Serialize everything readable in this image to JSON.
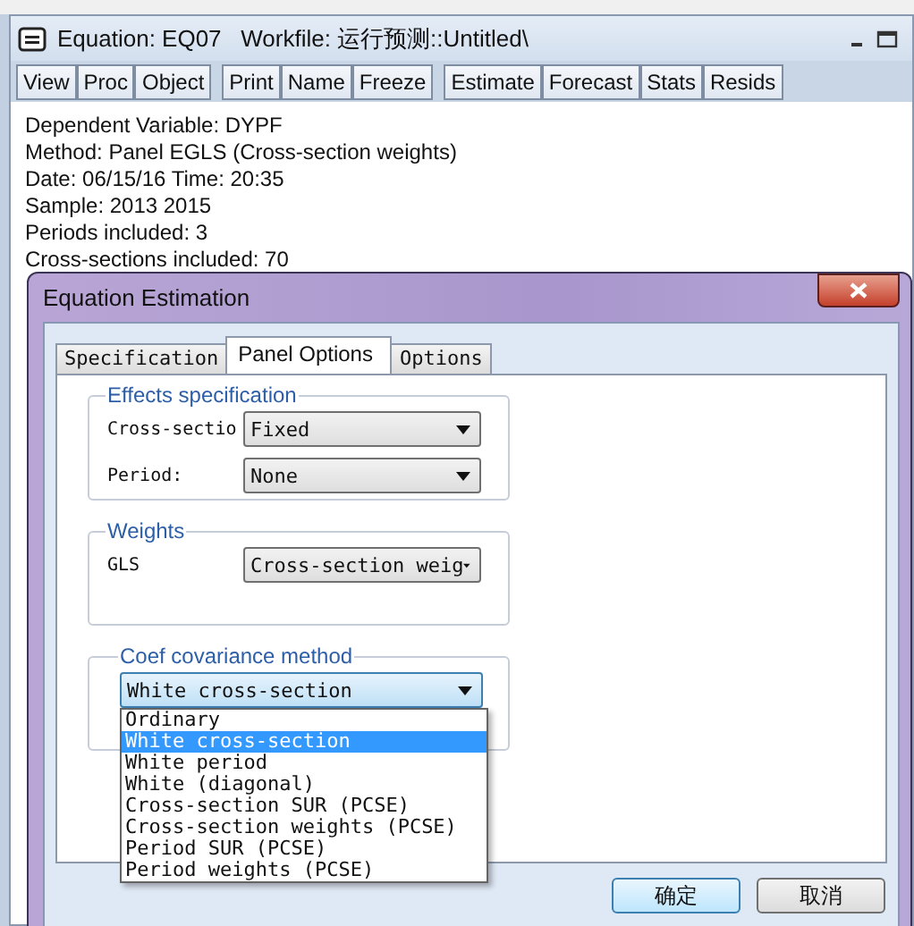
{
  "main_window": {
    "title": "Equation: EQ07   Workfile: 运行预测::Untitled\\",
    "toolbar": [
      [
        "View",
        "Proc",
        "Object"
      ],
      [
        "Print",
        "Name",
        "Freeze"
      ],
      [
        "Estimate",
        "Forecast",
        "Stats",
        "Resids"
      ]
    ],
    "output_lines": [
      "Dependent Variable: DYPF",
      "Method: Panel EGLS (Cross-section weights)",
      "Date: 06/15/16   Time: 20:35",
      "Sample: 2013 2015",
      "Periods included: 3",
      "Cross-sections included: 70"
    ]
  },
  "dialog": {
    "title": "Equation Estimation",
    "tabs": [
      {
        "label": "Specification",
        "selected": false
      },
      {
        "label": "Panel Options",
        "selected": true
      },
      {
        "label": "Options",
        "selected": false
      }
    ],
    "groups": [
      {
        "title": "Effects specification",
        "rows": [
          {
            "label": "Cross-sectio",
            "value": "Fixed",
            "open": false
          },
          {
            "label": "Period:",
            "value": "None",
            "open": false
          }
        ]
      },
      {
        "title": "Weights",
        "rows": [
          {
            "label": "GLS",
            "value": "Cross-section weig",
            "open": false
          }
        ]
      },
      {
        "title": "Coef covariance method",
        "rows": [
          {
            "value": "White cross-section",
            "open": true
          }
        ]
      }
    ],
    "dropdown_list": [
      {
        "label": "Ordinary",
        "selected": false
      },
      {
        "label": "White cross-section",
        "selected": true
      },
      {
        "label": "White period",
        "selected": false
      },
      {
        "label": "White (diagonal)",
        "selected": false
      },
      {
        "label": "Cross-section SUR (PCSE)",
        "selected": false
      },
      {
        "label": "Cross-section weights (PCSE)",
        "selected": false
      },
      {
        "label": "Period SUR (PCSE)",
        "selected": false
      },
      {
        "label": "Period weights (PCSE)",
        "selected": false
      }
    ],
    "buttons": [
      "确定",
      "取消"
    ]
  }
}
